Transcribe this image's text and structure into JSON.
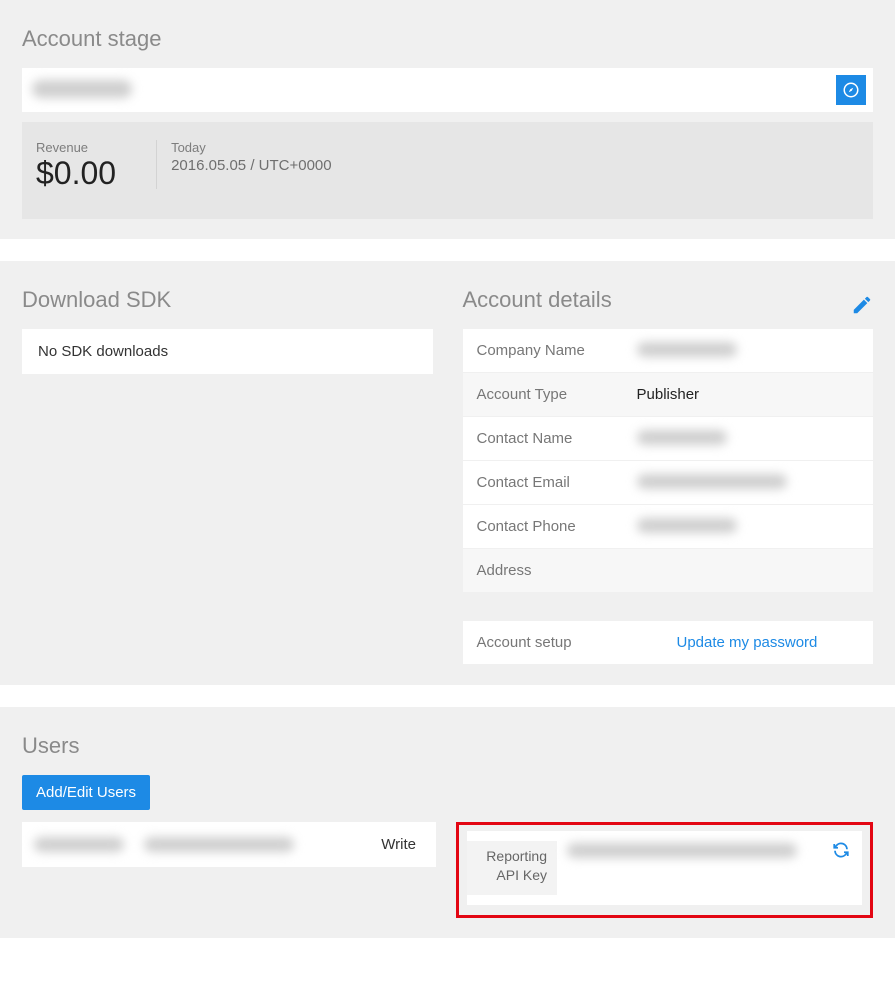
{
  "account_stage": {
    "title": "Account stage",
    "revenue_label": "Revenue",
    "revenue_value": "$0.00",
    "today_label": "Today",
    "today_value": "2016.05.05 / UTC+0000"
  },
  "download_sdk": {
    "title": "Download SDK",
    "empty_text": "No SDK downloads"
  },
  "account_details": {
    "title": "Account details",
    "rows": {
      "company_label": "Company Name",
      "type_label": "Account Type",
      "type_value": "Publisher",
      "contact_name_label": "Contact Name",
      "contact_email_label": "Contact Email",
      "contact_phone_label": "Contact Phone",
      "address_label": "Address",
      "setup_label": "Account setup",
      "setup_link": "Update my password"
    }
  },
  "users": {
    "title": "Users",
    "add_edit_label": "Add/Edit Users",
    "permission": "Write",
    "api_key_label_line1": "Reporting",
    "api_key_label_line2": "API Key"
  }
}
